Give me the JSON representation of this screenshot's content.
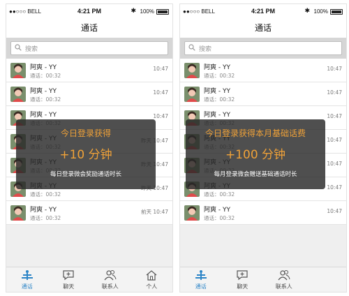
{
  "status_bar": {
    "carrier": "●●○○○ BELL",
    "time": "4:21 PM",
    "battery": "100%"
  },
  "navbar_title": "通话",
  "search_placeholder": "搜索",
  "contact_name": "阿爽 - YY",
  "call_sub": "通话：00:32",
  "left_rows_times": [
    "10:47",
    "10:47",
    "10:47",
    "昨天 10:47",
    "昨天 10:47",
    "昨天 10:47",
    "前天 10:47"
  ],
  "right_rows_times": [
    "10:47",
    "10:47",
    "10:47",
    "10:47",
    "10:47",
    "10:47",
    "10:47"
  ],
  "left_toast": {
    "title": "今日登录获得",
    "amount": "+10 分钟",
    "desc": "每日登录微会奖励通话时长"
  },
  "right_toast": {
    "title": "今日登录获得本月基础话费",
    "amount": "+100 分钟",
    "desc": "每月登录微会赠送基础通话时长"
  },
  "tabs_left": [
    "通话",
    "聊天",
    "联系人",
    "个人"
  ],
  "tabs_right": [
    "通话",
    "聊天",
    "联系人"
  ],
  "colors": {
    "accent": "#2d85c7",
    "toast_text": "#f0a238"
  }
}
